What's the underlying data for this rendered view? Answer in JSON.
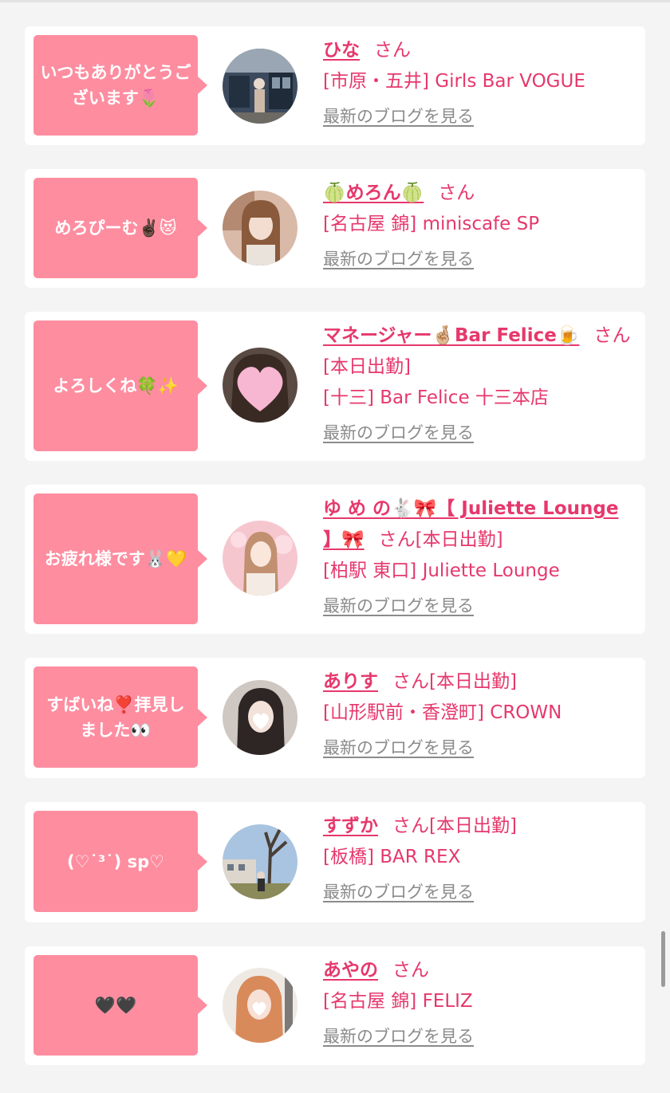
{
  "colors": {
    "accent": "#e6386c",
    "bubble": "#fe8da0",
    "link_gray": "#8b8b8b",
    "background": "#f4f4f4"
  },
  "cards": [
    {
      "message": "いつもありがとうございます🌷",
      "name": "ひな",
      "honorific": "さん",
      "status": "",
      "shop": "[市原・五井] Girls Bar VOGUE",
      "blog_link": "最新のブログを見る",
      "avatar_icon": "avatar-photo-icon"
    },
    {
      "message": "めろぴーむ✌🏿😻",
      "name": "🍈めろん🍈",
      "honorific": "さん",
      "status": "",
      "shop": "[名古屋 錦] miniscafe SP",
      "blog_link": "最新のブログを見る",
      "avatar_icon": "avatar-photo-icon"
    },
    {
      "message": "よろしくね🍀✨",
      "name": "マネージャー🤞🏼Bar Felice🍺",
      "honorific": "さん",
      "status": "[本日出勤]",
      "shop": "[十三] Bar Felice 十三本店",
      "blog_link": "最新のブログを見る",
      "avatar_icon": "avatar-heart-icon"
    },
    {
      "message": "お疲れ様です🐰💛",
      "name": "ゆ め の🐇🎀【 Juliette Lounge 】🎀",
      "honorific": "さん",
      "status": "[本日出勤]",
      "shop": "[柏駅 東口] Juliette Lounge",
      "blog_link": "最新のブログを見る",
      "avatar_icon": "avatar-photo-icon"
    },
    {
      "message": "すばいね❣️拝見しました👀",
      "name": "ありす",
      "honorific": "さん",
      "status": "[本日出勤]",
      "shop": "[山形駅前・香澄町] CROWN",
      "blog_link": "最新のブログを見る",
      "avatar_icon": "avatar-photo-icon"
    },
    {
      "message": "(♡˙³˙) sp♡",
      "name": "すずか",
      "honorific": "さん",
      "status": "[本日出勤]",
      "shop": "[板橋] BAR REX",
      "blog_link": "最新のブログを見る",
      "avatar_icon": "avatar-photo-icon"
    },
    {
      "message": "🖤🖤",
      "name": "あやの",
      "honorific": "さん",
      "status": "",
      "shop": "[名古屋 錦] FELIZ",
      "blog_link": "最新のブログを見る",
      "avatar_icon": "avatar-photo-icon"
    }
  ]
}
